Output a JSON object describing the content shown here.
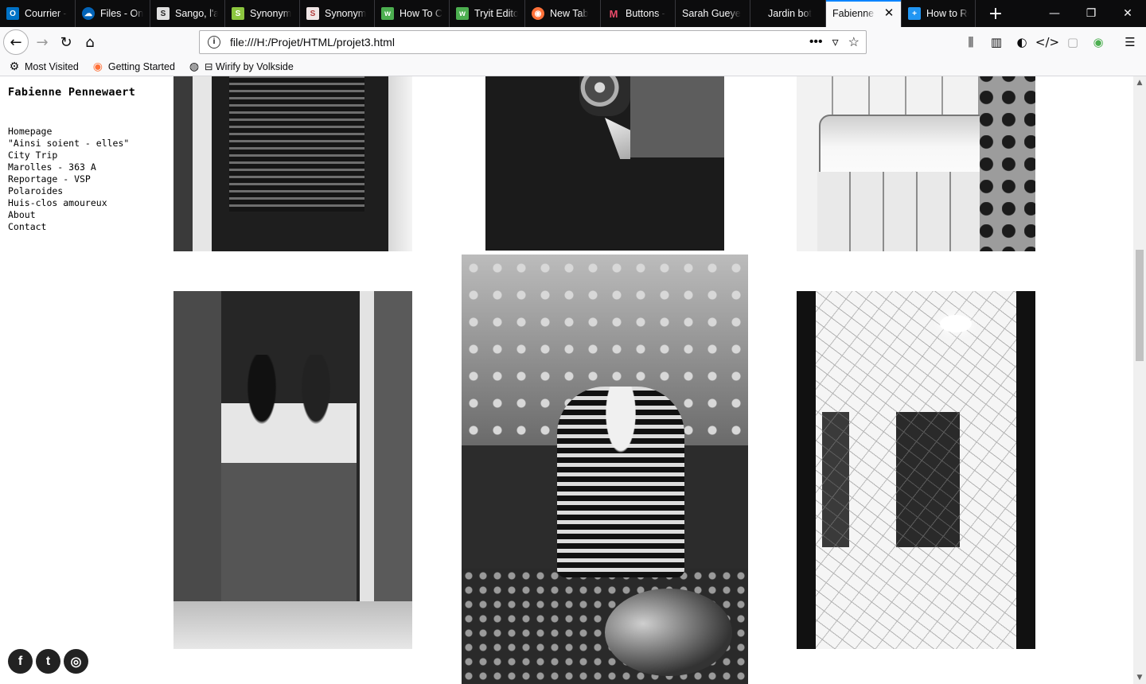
{
  "browser": {
    "tabs": [
      {
        "label": "Courrier -",
        "icon": "outlook-icon",
        "color": "#0072c6"
      },
      {
        "label": "Files - On",
        "icon": "onedrive-icon",
        "color": "#0364b8"
      },
      {
        "label": "Sango, l'a",
        "icon": "sango-icon",
        "color": "#444444"
      },
      {
        "label": "Synonym",
        "icon": "synonym-icon",
        "color": "#8cc63f"
      },
      {
        "label": "Synonym",
        "icon": "synonym2-icon",
        "color": "#b23b3b"
      },
      {
        "label": "How To C",
        "icon": "w3-icon",
        "color": "#4caf50"
      },
      {
        "label": "Tryit Edito",
        "icon": "w3-icon",
        "color": "#4caf50"
      },
      {
        "label": "New Tab",
        "icon": "firefox-icon",
        "color": "#ff7139"
      },
      {
        "label": "Buttons -",
        "icon": "buttons-icon",
        "color": "#e94b6a"
      },
      {
        "label": "Sarah Gueye",
        "icon": "blank-icon",
        "color": "#0c0c0d"
      },
      {
        "label": "Jardin bot",
        "icon": "blank-icon",
        "color": "#0c0c0d"
      },
      {
        "label": "Fabienne P",
        "icon": "blank-icon",
        "color": "#f9f9fa",
        "active": true
      },
      {
        "label": "How to Re",
        "icon": "plus-box-icon",
        "color": "#2196f3"
      }
    ],
    "url": "file:///H:/Projet/HTML/projet3.html",
    "bookmarks": [
      {
        "label": "Most Visited",
        "icon": "gear-icon"
      },
      {
        "label": "Getting Started",
        "icon": "firefox-icon"
      },
      {
        "label": "⊟ Wirify by Volkside",
        "icon": "globe-icon"
      }
    ]
  },
  "site": {
    "title": "Fabienne Pennewaert",
    "menu": [
      "Homepage",
      "\"Ainsi soient - elles\"",
      "City Trip",
      "Marolles - 363 A",
      "Reportage - VSP",
      "Polaroides",
      "Huis-clos amoureux",
      "About",
      "Contact"
    ],
    "social": [
      {
        "name": "facebook-icon",
        "glyph": "f"
      },
      {
        "name": "twitter-icon",
        "glyph": "t"
      },
      {
        "name": "instagram-icon",
        "glyph": "◎"
      }
    ]
  },
  "colors": {
    "accent": "#0a84ff",
    "tabbar": "#0c0c0d",
    "toolbar": "#f9f9fa"
  }
}
